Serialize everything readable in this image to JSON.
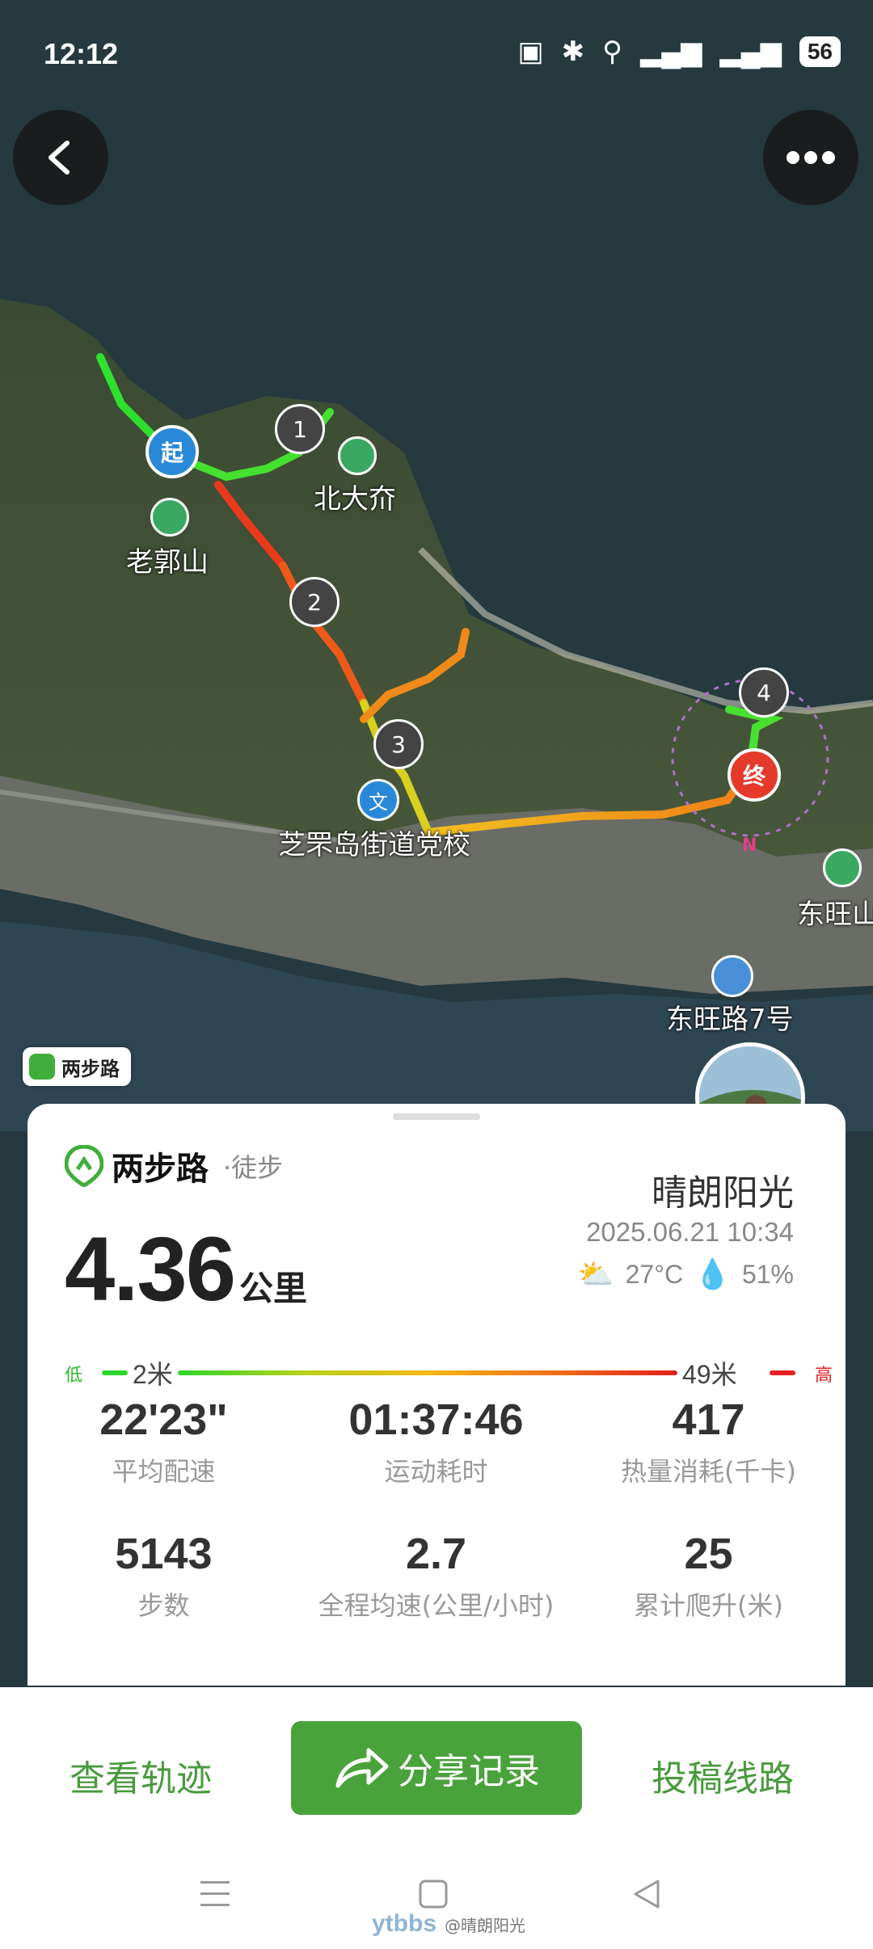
{
  "status_bar": {
    "time": "12:12",
    "battery": "56"
  },
  "map": {
    "labels": {
      "start": "起",
      "end": "终",
      "beidajie": "北大夼",
      "laoguoshan": "老郭山",
      "school": "芝罘岛街道党校",
      "school_icon": "文",
      "dongwangshan": "东旺山",
      "dongwanglu": "东旺路7号",
      "north": "N"
    },
    "waypoints": [
      "1",
      "2",
      "3",
      "4"
    ],
    "brand_badge": "两步路"
  },
  "summary": {
    "brand": "两步路",
    "activity": "·徒步",
    "user": "晴朗阳光",
    "date": "2025.06.21 10:34",
    "temperature": "27°C",
    "humidity": "51%",
    "distance": "4.36",
    "distance_unit": "公里",
    "elevation": {
      "low_label": "低",
      "high_label": "高",
      "min": "2米",
      "max": "49米"
    },
    "stats": [
      {
        "value": "22'23\"",
        "label": "平均配速"
      },
      {
        "value": "01:37:46",
        "label": "运动耗时"
      },
      {
        "value": "417",
        "label": "热量消耗(千卡)"
      },
      {
        "value": "5143",
        "label": "步数"
      },
      {
        "value": "2.7",
        "label": "全程均速(公里/小时)"
      },
      {
        "value": "25",
        "label": "累计爬升(米)"
      }
    ]
  },
  "actions": {
    "view_track": "查看轨迹",
    "share": "分享记录",
    "submit_route": "投稿线路"
  },
  "watermark": {
    "logo": "ytbbs",
    "user": "@晴朗阳光"
  },
  "colors": {
    "accent": "#4aa23c",
    "track_low": "#2bd52b",
    "track_high": "#e22020"
  }
}
